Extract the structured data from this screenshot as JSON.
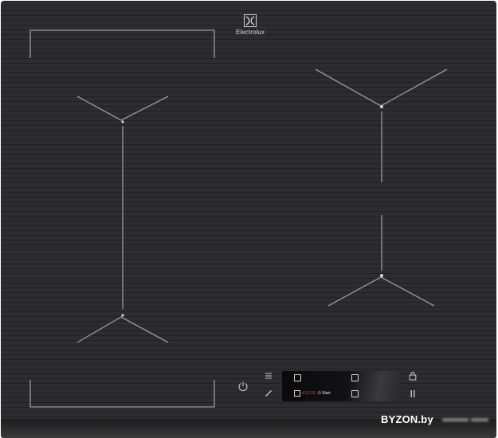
{
  "product": {
    "brand": "Electrolux",
    "colors": {
      "glass": "#2d2d2f",
      "zone_line": "#9a9a9c",
      "display_bg": "#0d0d0e",
      "display_digits": "#e0453a",
      "watermark": "#ffffff"
    }
  },
  "controls": {
    "power_icon": "power-icon",
    "menu_icon": "menu-lines-icon",
    "edit_icon": "pencil-icon",
    "lock_icon": "padlock-icon",
    "pause_icon": "pause-icon",
    "display": {
      "timer_digits": "d 12:15",
      "start_label": "Start",
      "start_icon": "power-icon"
    }
  },
  "watermark": {
    "text": "BYZON.by"
  }
}
